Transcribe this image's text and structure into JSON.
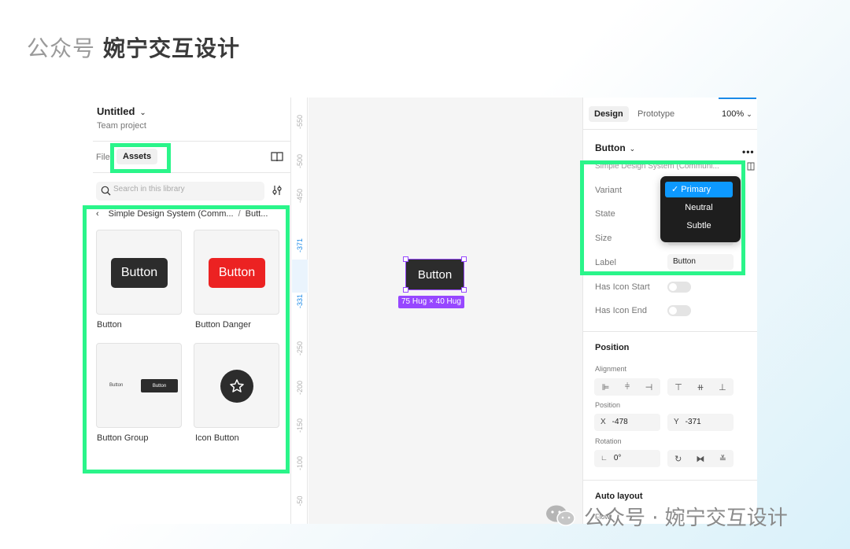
{
  "brand": {
    "prefix": "公众号",
    "name": "婉宁交互设计"
  },
  "file": {
    "title": "Untitled",
    "subtitle": "Team project"
  },
  "left_tabs": {
    "file": "File",
    "assets": "Assets"
  },
  "search": {
    "placeholder": "Search in this library"
  },
  "breadcrumb": {
    "library": "Simple Design System (Comm...",
    "separator": "/",
    "current": "Butt..."
  },
  "assets": [
    {
      "label": "Button",
      "preview": "Button"
    },
    {
      "label": "Button Danger",
      "preview": "Button"
    },
    {
      "label": "Button Group",
      "preview_text": "Button",
      "preview_button": "Button"
    },
    {
      "label": "Icon Button"
    }
  ],
  "ruler": {
    "ticks": [
      "-550",
      "-500",
      "-450",
      "-371",
      "-331",
      "-250",
      "-200",
      "-150",
      "-100",
      "-50"
    ]
  },
  "canvas": {
    "button_label": "Button",
    "size_badge": "75 Hug × 40 Hug"
  },
  "right_tabs": {
    "design": "Design",
    "prototype": "Prototype",
    "zoom": "100%"
  },
  "component": {
    "name": "Button",
    "library": "Simple Design System (Communi..."
  },
  "properties": {
    "variant_label": "Variant",
    "state_label": "State",
    "size_label": "Size",
    "label_label": "Label",
    "label_value": "Button",
    "has_icon_start": "Has Icon Start",
    "has_icon_end": "Has Icon End"
  },
  "variant_dropdown": {
    "options": [
      "Primary",
      "Neutral",
      "Subtle"
    ],
    "selected": "Primary"
  },
  "position": {
    "title": "Position",
    "alignment_label": "Alignment",
    "position_label": "Position",
    "x_axis": "X",
    "x": "-478",
    "y_axis": "Y",
    "y": "-371",
    "rotation_label": "Rotation",
    "rotation": "0°"
  },
  "auto_layout": {
    "title": "Auto layout",
    "flow_label": "Flow"
  },
  "watermark": {
    "text": "公众号 · 婉宁交互设计"
  },
  "colors": {
    "highlight": "#2af58a",
    "selection": "#9747ff",
    "accent": "#0d99ff",
    "danger": "#ec2222"
  }
}
